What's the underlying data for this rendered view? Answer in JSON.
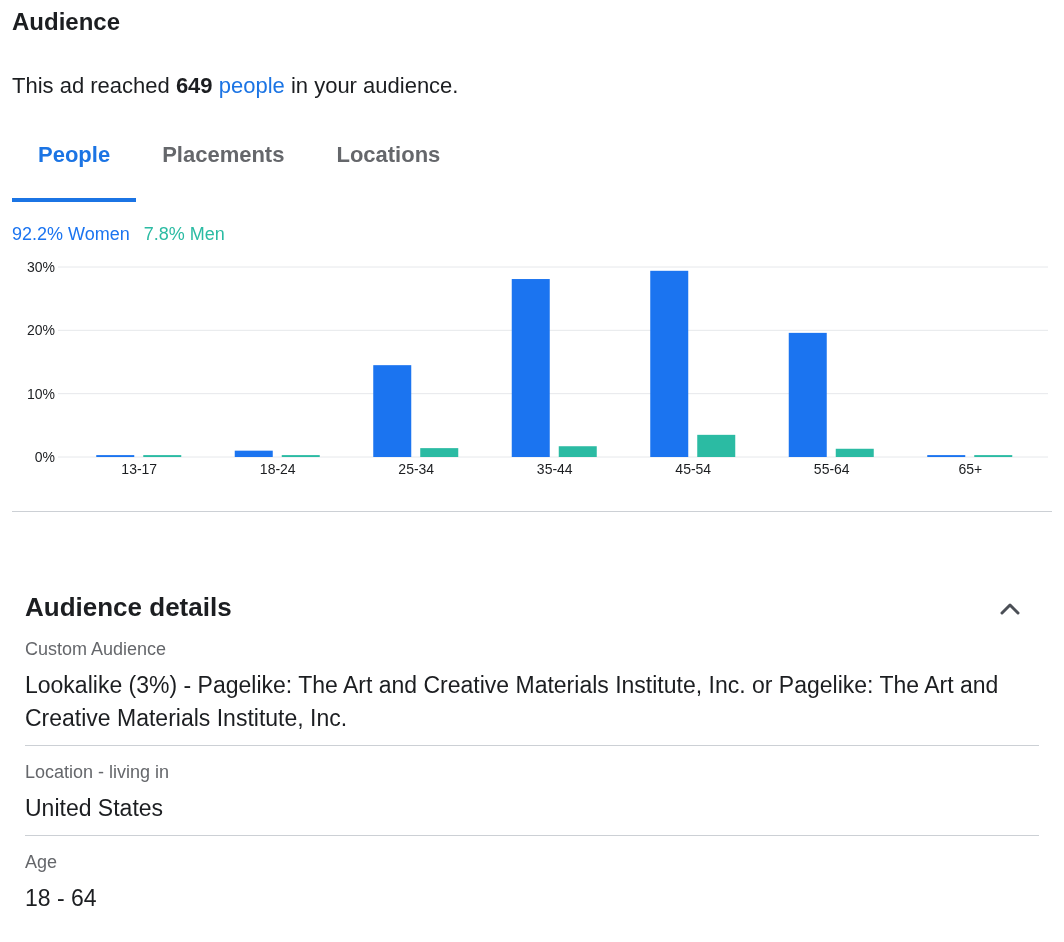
{
  "title": "Audience",
  "summary": {
    "text": "This ad reached **649**",
    "link": "people",
    "text_after": "in your audience."
  },
  "tabs": [
    {
      "label": "People",
      "selected": true
    },
    {
      "label": "Placements",
      "selected": false
    },
    {
      "label": "Locations",
      "selected": false
    }
  ],
  "chart_data": {
    "type": "bar",
    "categories": [
      "13-17",
      "18-24",
      "25-34",
      "35-44",
      "45-54",
      "55-64",
      "65+"
    ],
    "ylim": [
      0,
      30
    ],
    "yticks": [
      {
        "value": 0,
        "label": "0%"
      },
      {
        "value": 10,
        "label": "10%"
      },
      {
        "value": 20,
        "label": "20%"
      },
      {
        "value": 30,
        "label": "30%"
      }
    ],
    "series": [
      {
        "name": "92.2% Women",
        "color": "#1b74f0",
        "values": [
          0.3,
          1.0,
          14.5,
          28.1,
          29.4,
          19.6,
          0.3
        ]
      },
      {
        "name": "7.8% Men",
        "color": "#2bbba3",
        "values": [
          0.3,
          0.3,
          1.4,
          1.7,
          3.5,
          1.3,
          0.3
        ]
      }
    ]
  },
  "details": {
    "title": "Audience details",
    "expanded": true,
    "items": [
      {
        "label": "Custom Audience",
        "value": "Lookalike (3%) - Pagelike: The Art and Creative Materials Institute, Inc. or Pagelike: The Art and Creative Materials Institute, Inc."
      },
      {
        "label": "Location - living in",
        "value": "United States"
      },
      {
        "label": "Age",
        "value": "18 - 64"
      }
    ]
  }
}
